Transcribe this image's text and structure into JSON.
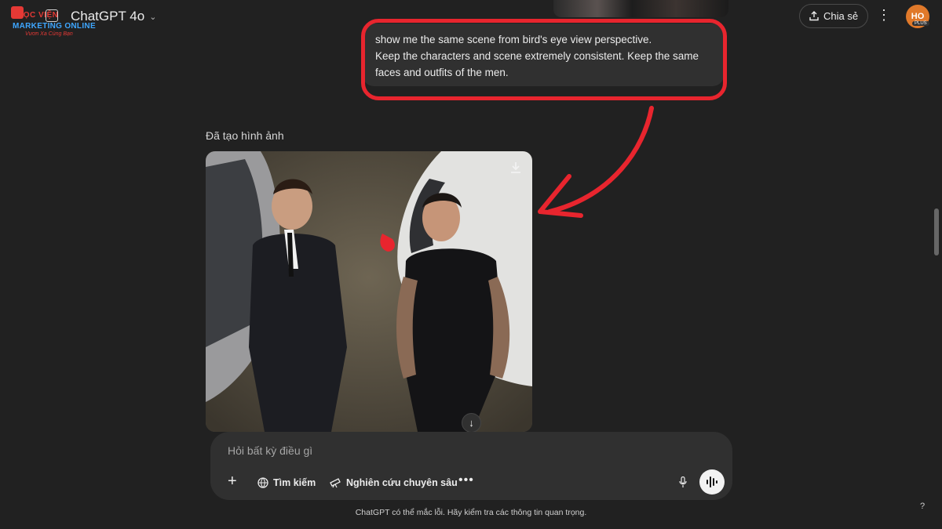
{
  "header": {
    "brand_line1": "HỌC VIỆN",
    "brand_line2": "MARKETING ONLINE",
    "slogan": "Vươn Xa Cùng Bạn",
    "model_name": "ChatGPT 4o",
    "share_label": "Chia sẻ",
    "avatar_initials": "HO",
    "avatar_badge": "PLUS"
  },
  "conversation": {
    "user_message_lines": [
      "show me the same scene from bird's eye view perspective.",
      "Keep the characters and scene extremely consistent. Keep the same",
      "faces and outfits of the men."
    ],
    "assistant_label": "Đã tạo hình ảnh"
  },
  "composer": {
    "placeholder": "Hỏi bất kỳ điều gì",
    "search_label": "Tìm kiếm",
    "research_label": "Nghiên cứu chuyên sâu"
  },
  "footer": {
    "disclaimer": "ChatGPT có thể mắc lỗi. Hãy kiểm tra các thông tin quan trọng.",
    "help": "?"
  },
  "colors": {
    "background": "#212121",
    "bubble": "#303030",
    "highlight": "#e8252e",
    "avatar": "#e0792a"
  }
}
